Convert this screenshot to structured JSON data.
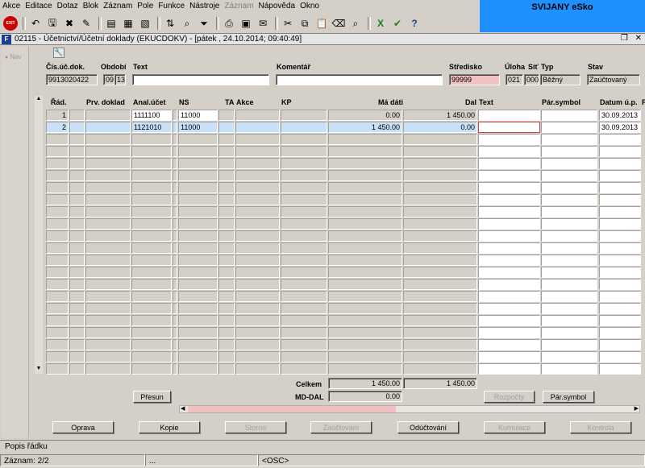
{
  "menu": [
    "Akce",
    "Editace",
    "Dotaz",
    "Blok",
    "Záznam",
    "Pole",
    "Funkce",
    "Nástroje",
    "Záznam",
    "Nápověda",
    "Okno"
  ],
  "brand": "SVIJANY eSko",
  "window": {
    "icon_text": "F",
    "title": "02115 - Účetnictví/Účetní doklady (EKUCDOKV) - [pátek , 24.10.2014; 09:40:49]"
  },
  "nav": {
    "label": "Nav"
  },
  "header": {
    "labels": {
      "cis": "Čís.úč.dok.",
      "obdobi": "Období",
      "text": "Text",
      "komentar": "Komentář",
      "stredisko": "Středisko",
      "uloha": "Úloha",
      "sit": "Síť",
      "typ": "Typ",
      "stav": "Stav"
    },
    "values": {
      "cis": "9913020422",
      "obdobi_m": "09",
      "obdobi_y": "13",
      "text": "",
      "komentar": "",
      "stredisko": "99999",
      "uloha": "021",
      "sit": "000",
      "typ": "Běžný",
      "stav": "Zaúčtovaný"
    }
  },
  "grid": {
    "columns": [
      "Řád.",
      "Prv. doklad",
      "Anal.účet",
      "NS",
      "TA",
      "Akce",
      "KP",
      "Má dáti",
      "Dal",
      "Text",
      "Pár.symbol",
      "Datum ú.p.",
      "P"
    ],
    "rows": [
      {
        "rad": "1",
        "prv": "",
        "anal": "1111100",
        "ns": "11000",
        "ta": "",
        "akce": "",
        "kp": "",
        "ma_dati": "0.00",
        "dal": "1 450.00",
        "text": "",
        "par": "",
        "datum": "30.09.2013"
      },
      {
        "rad": "2",
        "prv": "",
        "anal": "1121010",
        "ns": "11000",
        "ta": "",
        "akce": "",
        "kp": "",
        "ma_dati": "1 450.00",
        "dal": "0.00",
        "text": "",
        "par": "",
        "datum": "30.09.2013"
      }
    ]
  },
  "totals": {
    "celkem_label": "Celkem",
    "celkem_ma": "1 450.00",
    "celkem_dal": "1 450.00",
    "mddal_label": "MD-DAL",
    "mddal_value": "0.00"
  },
  "buttons": {
    "presun": "Přesun",
    "rozpocty": "Rozpočty",
    "par_symbol": "Pár.symbol",
    "oprava": "Oprava",
    "kopie": "Kopie",
    "storno": "Storno",
    "zauctovani": "Zaúčtování",
    "oductovani": "Odúčtování",
    "kumulace": "Kumulace",
    "kontrola": "Kontrola"
  },
  "status": {
    "description": "Popis řádku",
    "zaznam": "Záznam: 2/2",
    "mid": "...",
    "osc": "<OSC>"
  },
  "colors": {
    "brand_bg": "#1e90ff",
    "selected_row": "#c8e0f8",
    "stredisko_bg": "#f4c0c0"
  }
}
